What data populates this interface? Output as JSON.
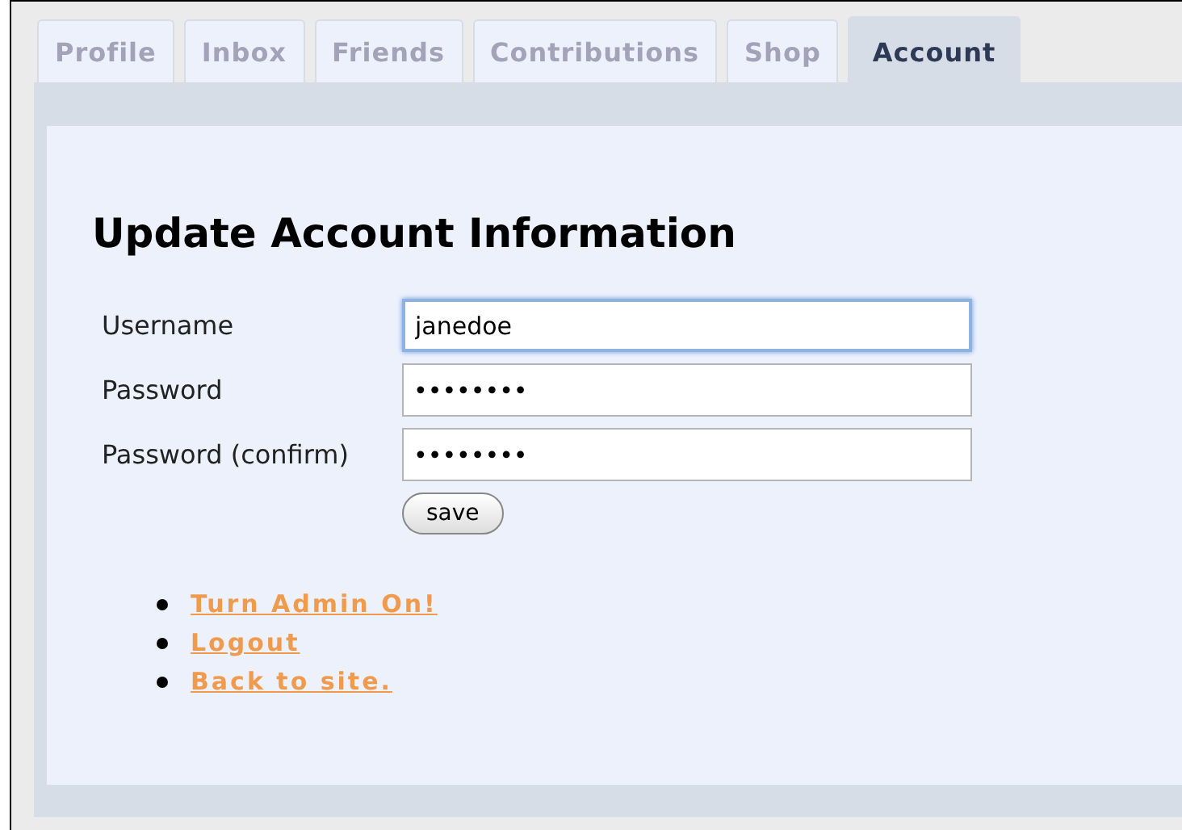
{
  "tabs": [
    {
      "label": "Profile",
      "selected": false
    },
    {
      "label": "Inbox",
      "selected": false
    },
    {
      "label": "Friends",
      "selected": false
    },
    {
      "label": "Contributions",
      "selected": false
    },
    {
      "label": "Shop",
      "selected": false
    },
    {
      "label": "Account",
      "selected": true
    }
  ],
  "heading": "Update Account Information",
  "fields": [
    {
      "label": "Username",
      "value": "janedoe",
      "focused": true
    },
    {
      "label": "Password",
      "value": "••••••••",
      "focused": false
    },
    {
      "label": "Password (confirm)",
      "value": "••••••••",
      "focused": false
    }
  ],
  "save_button": "save",
  "links": [
    "Turn Admin On!",
    "Logout",
    "Back to site."
  ]
}
